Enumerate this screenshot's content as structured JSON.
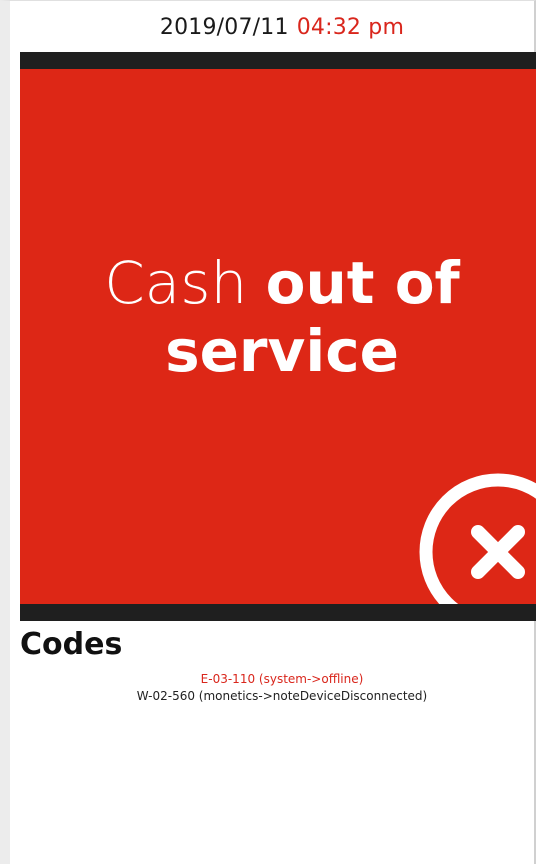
{
  "header": {
    "date": "2019/07/11",
    "time": "04:32 pm"
  },
  "status": {
    "message_light": "Cash",
    "message_bold_line1": "out of",
    "message_bold_line2": "service",
    "icon": "close-circle-icon"
  },
  "codes": {
    "title": "Codes",
    "items": [
      {
        "text": "E-03-110 (system->offline)",
        "level": "error"
      },
      {
        "text": "W-02-560 (monetics->noteDeviceDisconnected)",
        "level": "warning"
      }
    ]
  },
  "colors": {
    "panel": "#dd2716",
    "bar": "#1f1f1f",
    "accent": "#d9261c"
  }
}
